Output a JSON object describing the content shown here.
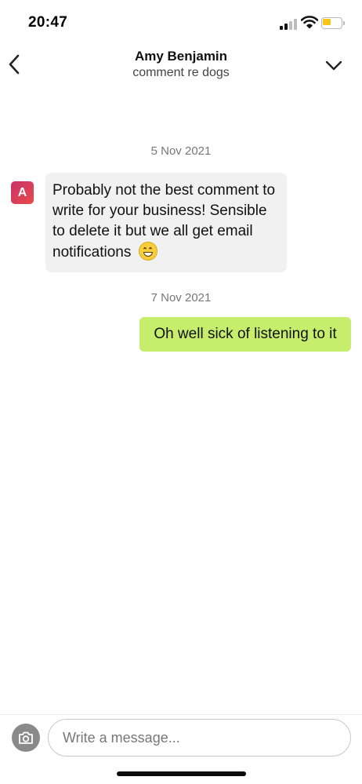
{
  "status_bar": {
    "time": "20:47",
    "signal_icon": "signal-bars-icon",
    "wifi_icon": "wifi-icon",
    "battery_icon": "battery-low-icon",
    "battery_color": "#f5c518"
  },
  "header": {
    "back_icon": "chevron-left-icon",
    "contact_name": "Amy Benjamin",
    "subject": "comment re dogs",
    "options_icon": "chevron-down-icon"
  },
  "conversation": {
    "date_1": "5 Nov 2021",
    "incoming": {
      "avatar_initial": "A",
      "avatar_colors": [
        "#c8326a",
        "#e84a4a"
      ],
      "text": "Probably not the best comment to write for your business! Sensible to delete it but we all get email notifications",
      "emoji": "grinning-face-icon",
      "bubble_color": "#f1f1f1"
    },
    "date_2": "7 Nov 2021",
    "outgoing": {
      "text": "Oh well sick of listening to it",
      "bubble_color": "#c6ee6c"
    }
  },
  "composer": {
    "camera_icon": "camera-icon",
    "placeholder": "Write a message...",
    "value": ""
  }
}
